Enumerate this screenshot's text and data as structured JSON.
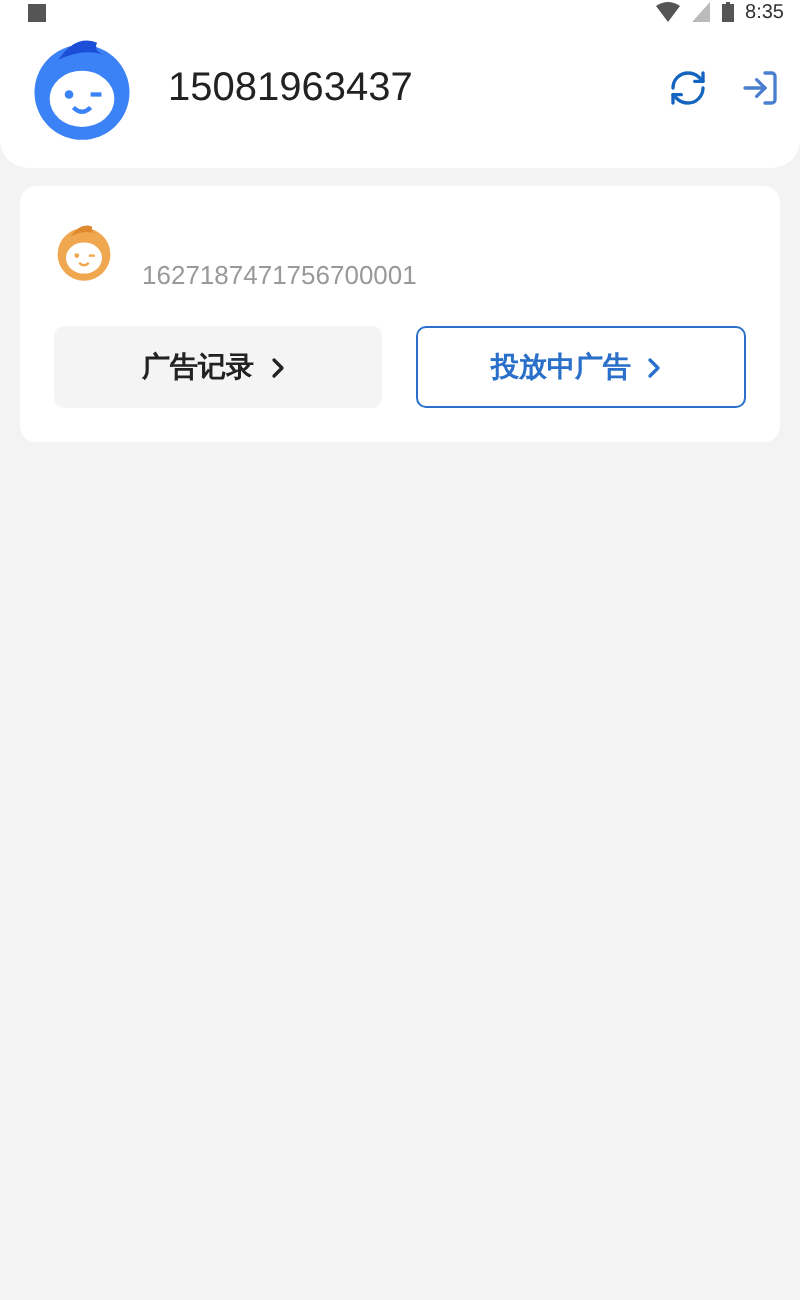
{
  "status_bar": {
    "time": "8:35"
  },
  "header": {
    "phone": "15081963437"
  },
  "card": {
    "account_id": "1627187471756700001",
    "buttons": [
      {
        "label": "广告记录",
        "kind": "plain"
      },
      {
        "label": "投放中广告",
        "kind": "outlined"
      }
    ]
  }
}
